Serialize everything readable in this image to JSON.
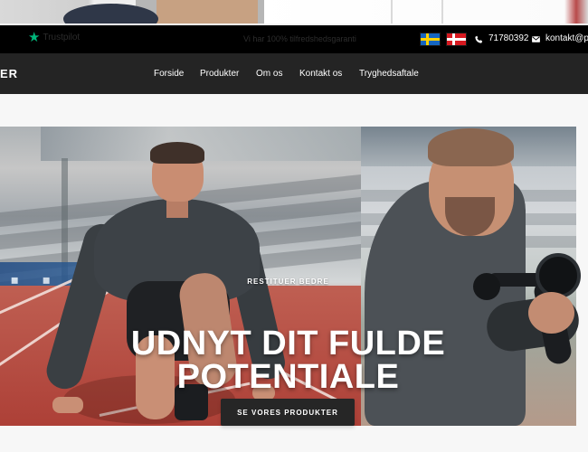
{
  "topbar": {
    "trustpilot_label": "Trustpilot",
    "announcement": "Vi har 100% tilfredshedsgaranti",
    "phone": "71780392",
    "email": "kontakt@p",
    "flags": [
      "Sweden flag",
      "Denmark flag"
    ]
  },
  "nav": {
    "logo_fragment": "ER",
    "items": [
      {
        "label": "Forside"
      },
      {
        "label": "Produkter"
      },
      {
        "label": "Om os"
      },
      {
        "label": "Kontakt os"
      },
      {
        "label": "Tryghedsaftale"
      }
    ]
  },
  "hero": {
    "eyebrow": "RESTITUER BEDRE",
    "title_line_1": "UDNYT DIT FULDE",
    "title_line_2": "POTENTIALE",
    "button_label": "SE VORES PRODUKTER"
  },
  "colors": {
    "topbar": "#000000",
    "nav": "#242424",
    "button": "#262626",
    "trustpilot_star": "#00b67a"
  },
  "icons": {
    "trustpilot": "star-icon",
    "phone": "phone-icon",
    "email": "email-icon"
  }
}
